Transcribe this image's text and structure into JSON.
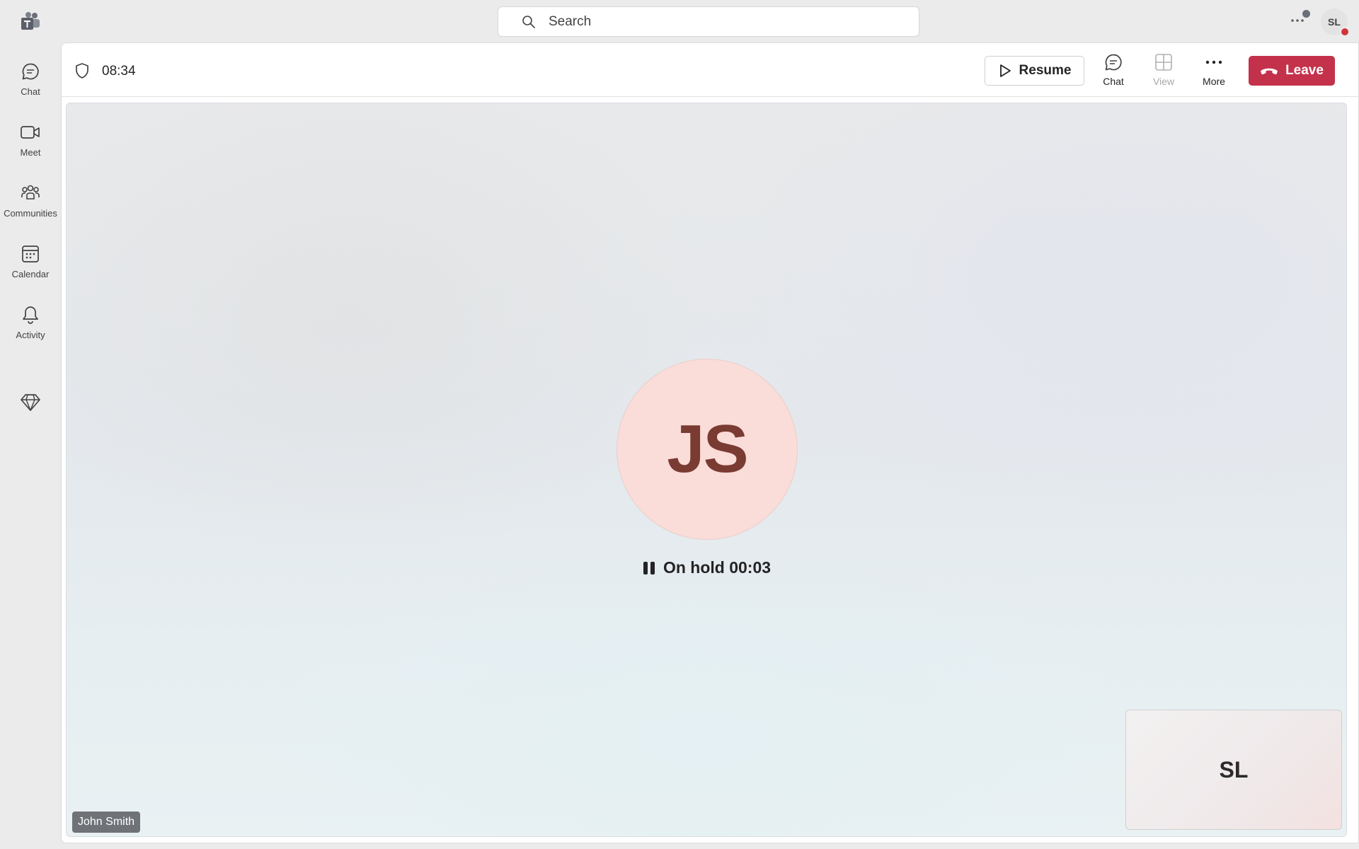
{
  "search": {
    "placeholder": "Search"
  },
  "profile": {
    "initials": "SL"
  },
  "rail": {
    "items": [
      {
        "label": "Chat"
      },
      {
        "label": "Meet"
      },
      {
        "label": "Communities"
      },
      {
        "label": "Calendar"
      },
      {
        "label": "Activity"
      }
    ]
  },
  "call": {
    "elapsed": "08:34",
    "resume_label": "Resume",
    "chat_label": "Chat",
    "view_label": "View",
    "more_label": "More",
    "leave_label": "Leave",
    "caller_initials": "JS",
    "hold_status": "On hold 00:03",
    "caller_name": "John Smith",
    "self_initials": "SL"
  },
  "colors": {
    "leave": "#c4314b",
    "caller_avatar_bg": "#fadcd8",
    "caller_avatar_text": "#7a3b32",
    "presence_busy": "#d13438"
  }
}
